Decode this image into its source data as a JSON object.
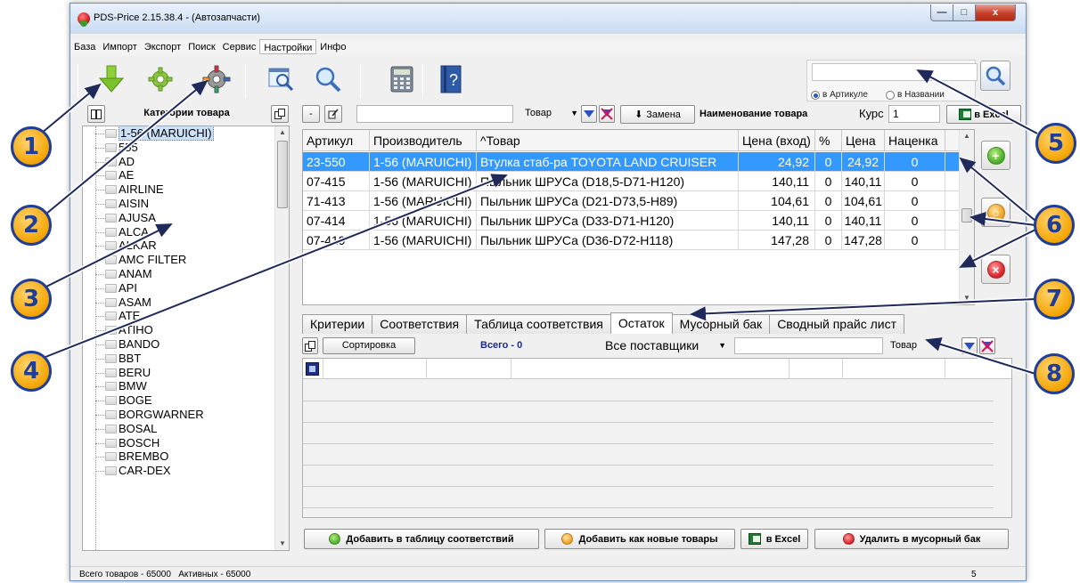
{
  "window": {
    "title": "PDS-Price 2.15.38.4 - (Автозапчасти)",
    "controls": {
      "minimize": "—",
      "maximize": "□",
      "close": "x"
    }
  },
  "menu": [
    {
      "label": "База"
    },
    {
      "label": "Импорт"
    },
    {
      "label": "Экспорт"
    },
    {
      "label": "Поиск"
    },
    {
      "label": "Сервис"
    },
    {
      "label": "Настройки",
      "active": true
    },
    {
      "label": "Инфо"
    }
  ],
  "toolbar": {
    "icons": [
      "download-arrow-icon",
      "gear-green-icon",
      "gear-colorful-icon",
      "window-search-icon",
      "magnifier-icon",
      "calculator-icon",
      "help-book-icon"
    ],
    "search": {
      "value": "",
      "radio_article": "в Артикуле",
      "radio_name": "в Названии",
      "selected": "article"
    }
  },
  "categories": {
    "title": "Категории товара",
    "selected": "1-56 (MARUICHI)",
    "items": [
      "1-56 (MARUICHI)",
      "555",
      "AD",
      "AE",
      "AIRLINE",
      "AISIN",
      "AJUSA",
      "ALCA",
      "ALKAR",
      "AMC FILTER",
      "ANAM",
      "API",
      "ASAM",
      "ATE",
      "ATIHO",
      "BANDO",
      "BBT",
      "BERU",
      "BMW",
      "BOGE",
      "BORGWARNER",
      "BOSAL",
      "BOSCH",
      "BREMBO",
      "CAR-DEX"
    ]
  },
  "products_bar": {
    "minus_label": "-",
    "filter_value": "",
    "combo_value": "Товар",
    "replace_label": "Замена",
    "name_label": "Наименование товара",
    "rate_label": "Курс",
    "rate_value": "1",
    "excel_label": "в Excel"
  },
  "products_grid": {
    "columns": [
      "Артикул",
      "Производитель",
      "^Товар",
      "Цена (вход)",
      "%",
      "Цена",
      "Наценка"
    ],
    "rows": [
      {
        "article": "23-550",
        "maker": "1-56 (MARUICHI)",
        "product": "Втулка стаб-ра TOYOTA LAND CRUISER",
        "price_in": "24,92",
        "percent": "0",
        "price": "24,92",
        "markup": "0",
        "selected": true
      },
      {
        "article": "07-415",
        "maker": "1-56 (MARUICHI)",
        "product": "Пыльник ШРУСа (D18,5-D71-H120)",
        "price_in": "140,11",
        "percent": "0",
        "price": "140,11",
        "markup": "0"
      },
      {
        "article": "71-413",
        "maker": "1-56 (MARUICHI)",
        "product": "Пыльник ШРУСа (D21-D73,5-H89)",
        "price_in": "104,61",
        "percent": "0",
        "price": "104,61",
        "markup": "0"
      },
      {
        "article": "07-414",
        "maker": "1-56 (MARUICHI)",
        "product": "Пыльник ШРУСа (D33-D71-H120)",
        "price_in": "140,11",
        "percent": "0",
        "price": "140,11",
        "markup": "0"
      },
      {
        "article": "07-419",
        "maker": "1-56 (MARUICHI)",
        "product": "Пыльник ШРУСа (D36-D72-H118)",
        "price_in": "147,28",
        "percent": "0",
        "price": "147,28",
        "markup": "0"
      }
    ]
  },
  "side_buttons": [
    {
      "icon": "add-green-icon",
      "color": "#4cae2c",
      "symbol": "+"
    },
    {
      "icon": "edit-orange-icon",
      "color": "#f0a020",
      "symbol": "○"
    },
    {
      "icon": "delete-red-icon",
      "color": "#d8252b",
      "symbol": "×"
    }
  ],
  "tabs": [
    {
      "label": "Критерии"
    },
    {
      "label": "Соответствия"
    },
    {
      "label": "Таблица соответствия"
    },
    {
      "label": "Остаток",
      "active": true
    },
    {
      "label": "Мусорный бак"
    },
    {
      "label": "Сводный прайс лист"
    }
  ],
  "lower_panel": {
    "sort_label": "Сортировка",
    "total_label": "Всего - 0",
    "suppliers_value": "Все поставщики",
    "filter_value": "",
    "combo_value": "Товар"
  },
  "bottom_buttons": {
    "add_to_table": "Добавить в таблицу соответствий",
    "add_new": "Добавить как новые товары",
    "excel": "в Excel",
    "trash": "Удалить в мусорный бак"
  },
  "status": {
    "text": "Всего товаров - 65000   Активных - 65000",
    "right_value": "5"
  },
  "callouts": [
    "1",
    "2",
    "3",
    "4",
    "5",
    "6",
    "7",
    "8"
  ],
  "colors": {
    "selection": "#3399ff",
    "callout_fill": "#f5a80a",
    "callout_border": "#1f3e99"
  }
}
